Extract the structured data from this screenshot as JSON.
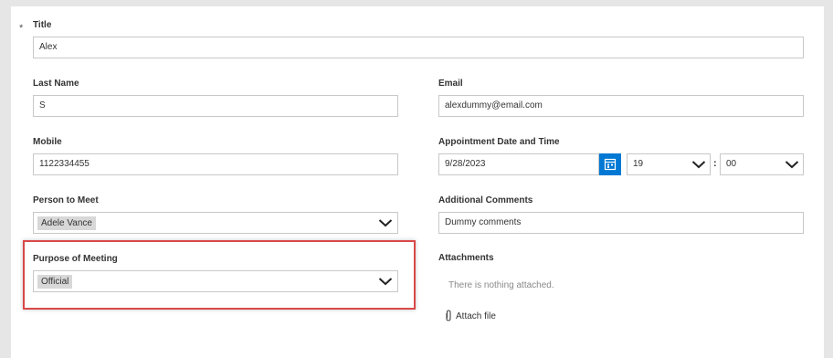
{
  "form": {
    "required_marker": "*",
    "title": {
      "label": "Title",
      "value": "Alex"
    },
    "last_name": {
      "label": "Last Name",
      "value": "S"
    },
    "email": {
      "label": "Email",
      "value": "alexdummy@email.com"
    },
    "mobile": {
      "label": "Mobile",
      "value": "1122334455"
    },
    "appointment": {
      "label": "Appointment Date and Time",
      "date": "9/28/2023",
      "hour": "19",
      "minute": "00",
      "separator": ":"
    },
    "person_to_meet": {
      "label": "Person to Meet",
      "value": "Adele Vance"
    },
    "additional_comments": {
      "label": "Additional Comments",
      "value": "Dummy comments"
    },
    "purpose": {
      "label": "Purpose of Meeting",
      "value": "Official"
    },
    "attachments": {
      "label": "Attachments",
      "empty_text": "There is nothing attached.",
      "attach_label": "Attach file"
    }
  },
  "colors": {
    "accent": "#0078d4",
    "highlight_border": "#d94848",
    "tag_bg": "#d8d8d8"
  },
  "icons": [
    "calendar-icon",
    "chevron-down-icon",
    "paperclip-icon"
  ]
}
